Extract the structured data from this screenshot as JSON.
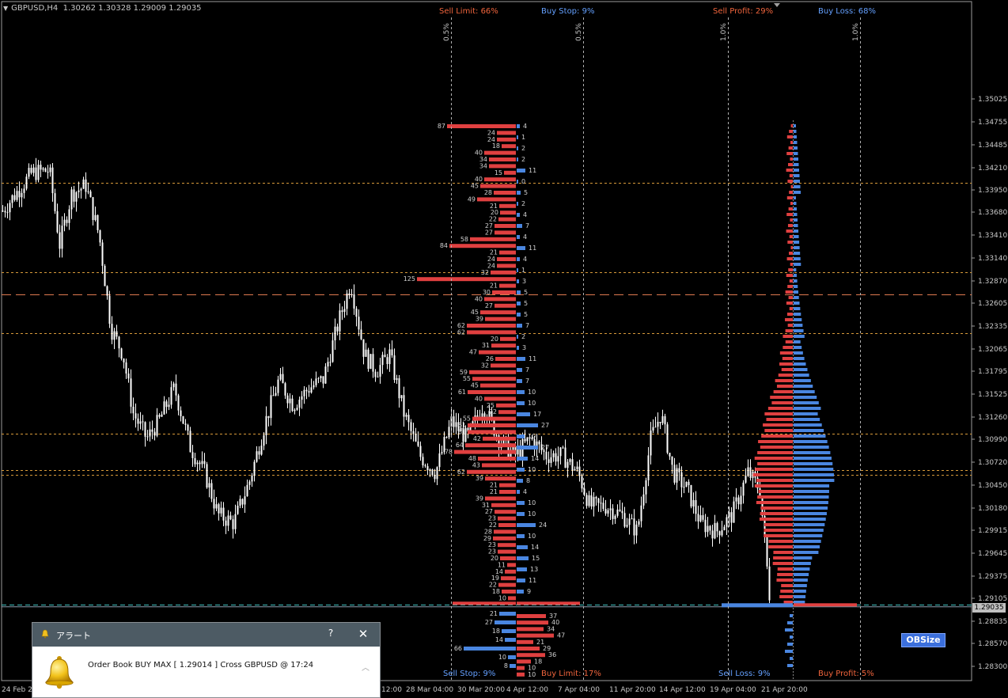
{
  "header": {
    "symbol": "GBPUSD,H4",
    "ohlc": "1.30262 1.30328 1.29009 1.29035"
  },
  "chart_data": {
    "type": "candlestick",
    "symbol": "GBPUSD",
    "timeframe": "H4",
    "ylim": [
      1.2817,
      1.3616
    ],
    "price_ticks": [
      "1.35025",
      "1.34755",
      "1.34485",
      "1.34210",
      "1.33950",
      "1.33680",
      "1.33410",
      "1.33140",
      "1.32870",
      "1.32605",
      "1.32335",
      "1.32065",
      "1.31795",
      "1.31525",
      "1.31260",
      "1.30990",
      "1.30720",
      "1.30450",
      "1.30180",
      "1.29915",
      "1.29645",
      "1.29375",
      "1.29105",
      "1.28835",
      "1.28570",
      "1.28300"
    ],
    "time_labels": [
      "24 Feb 20",
      "28 Mar 04:00",
      "30 Mar 20:00",
      "4 Apr 12:00",
      "7 Apr 04:00",
      "11 Apr 20:00",
      "14 Apr 12:00",
      "19 Apr 04:00",
      "21 Apr 20:00"
    ],
    "time_label_partial": "12:00",
    "current_price": "1.29035",
    "horizontal_levels": [
      1.3403,
      1.3297,
      1.3271,
      1.3225,
      1.3106,
      1.3063,
      1.3057,
      1.2903
    ],
    "order_book": {
      "top_labels": [
        "Sell Limit: 66%",
        "Buy Stop: 9%"
      ],
      "bottom_labels": [
        "Sell Stop: 9%",
        "Buy Limit: 17%"
      ],
      "dividers": [
        "0.5%",
        "0.5%"
      ],
      "sell_bar_values": [
        87,
        24,
        24,
        18,
        40,
        34,
        34,
        15,
        40,
        45,
        28,
        49,
        21,
        20,
        22,
        27,
        27,
        58,
        84,
        21,
        24,
        24,
        32,
        125,
        21,
        30,
        40,
        27,
        45,
        39,
        62,
        62,
        20,
        31,
        47,
        26,
        32,
        59,
        55,
        45,
        61,
        40,
        25,
        22,
        55,
        61,
        61,
        42,
        64,
        78,
        48,
        43,
        62,
        39,
        21,
        21,
        39,
        31,
        27,
        23,
        22,
        28,
        29,
        23,
        23,
        20,
        11,
        14,
        19,
        22,
        18,
        10
      ],
      "buy_bar_values": [
        4,
        1,
        2,
        2,
        11,
        0,
        5,
        2,
        4,
        7,
        4,
        11,
        4,
        1,
        3,
        5,
        5,
        5,
        7,
        2,
        3,
        11,
        7,
        7,
        10,
        10,
        17,
        27,
        10,
        27,
        14,
        10,
        8,
        4,
        10,
        10,
        24,
        10,
        14,
        15,
        13,
        11,
        9
      ],
      "lower_sell_values": [
        21,
        27,
        18,
        14,
        66,
        10,
        8
      ],
      "lower_buy_values": [
        37,
        40,
        34,
        47,
        21,
        29,
        36,
        18,
        10,
        10
      ]
    },
    "position_book": {
      "top_labels": [
        "Sell Profit: 29%",
        "Buy Loss: 68%"
      ],
      "bottom_labels": [
        "Sell Loss: 9%",
        "Buy Profit: 5%"
      ],
      "dividers": [
        "1.0%",
        "1.0%"
      ]
    }
  },
  "buttons": {
    "obsize": "OBSize"
  },
  "alert": {
    "title": "アラート",
    "help": "?",
    "close": "✕",
    "message": "Order Book BUY MAX [ 1.29014 ] Cross GBPUSD @ 17:24",
    "scroll": "︿"
  },
  "colors": {
    "background": "#000000",
    "candle": "#ffffff",
    "sell": "#e04040",
    "buy": "#4a86e0",
    "level": "#d89a3a",
    "current": "#40c0c0",
    "text": "#c8c8c8",
    "sell_label": "#f0643c",
    "buy_label": "#64a0ff"
  }
}
